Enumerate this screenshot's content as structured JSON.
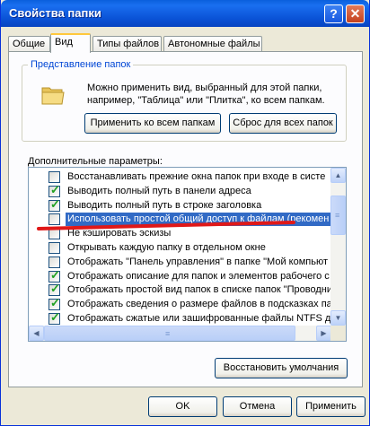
{
  "window": {
    "title": "Свойства папки",
    "help_label": "?",
    "close_label": "✕"
  },
  "tabs": [
    {
      "label": "Общие"
    },
    {
      "label": "Вид"
    },
    {
      "label": "Типы файлов"
    },
    {
      "label": "Автономные файлы"
    }
  ],
  "active_tab": "Вид",
  "folder_views": {
    "legend": "Представление папок",
    "description": "Можно применить вид, выбранный для этой папки, например, \"Таблица\" или \"Плитка\", ко всем папкам.",
    "apply_all_label": "Применить ко всем папкам",
    "reset_all_label": "Сброс для всех папок"
  },
  "advanced": {
    "label": "Дополнительные параметры:",
    "items": [
      {
        "label": "Восстанавливать прежние окна папок при входе в систе",
        "checked": false
      },
      {
        "label": "Выводить полный путь в панели адреса",
        "checked": true
      },
      {
        "label": "Выводить полный путь в строке заголовка",
        "checked": true
      },
      {
        "label": "Использовать простой общий доступ к файлам (рекомен",
        "checked": false,
        "selected": true
      },
      {
        "label": "Не кэшировать эскизы",
        "checked": false
      },
      {
        "label": "Открывать каждую папку в отдельном окне",
        "checked": false
      },
      {
        "label": "Отображать \"Панель управления\" в папке \"Мой компьют",
        "checked": false
      },
      {
        "label": "Отображать описание для папок и элементов рабочего с",
        "checked": true
      },
      {
        "label": "Отображать простой вид папок в списке папок \"Проводни",
        "checked": true
      },
      {
        "label": "Отображать сведения о размере файлов в подсказках па",
        "checked": true
      },
      {
        "label": "Отображать сжатые или зашифрованные файлы NTFS дру",
        "checked": true
      }
    ],
    "check_glyph": "✓",
    "scroll_up": "▲",
    "scroll_down": "▼",
    "scroll_left": "◀",
    "scroll_right": "▶",
    "grip": "≡"
  },
  "restore_defaults_label": "Восстановить умолчания",
  "footer": {
    "ok_label": "OK",
    "cancel_label": "Отмена",
    "apply_label": "Применить"
  },
  "colors": {
    "titlebar": "#0a52d6",
    "selection": "#316ac5",
    "annotation_line": "#e01818"
  }
}
